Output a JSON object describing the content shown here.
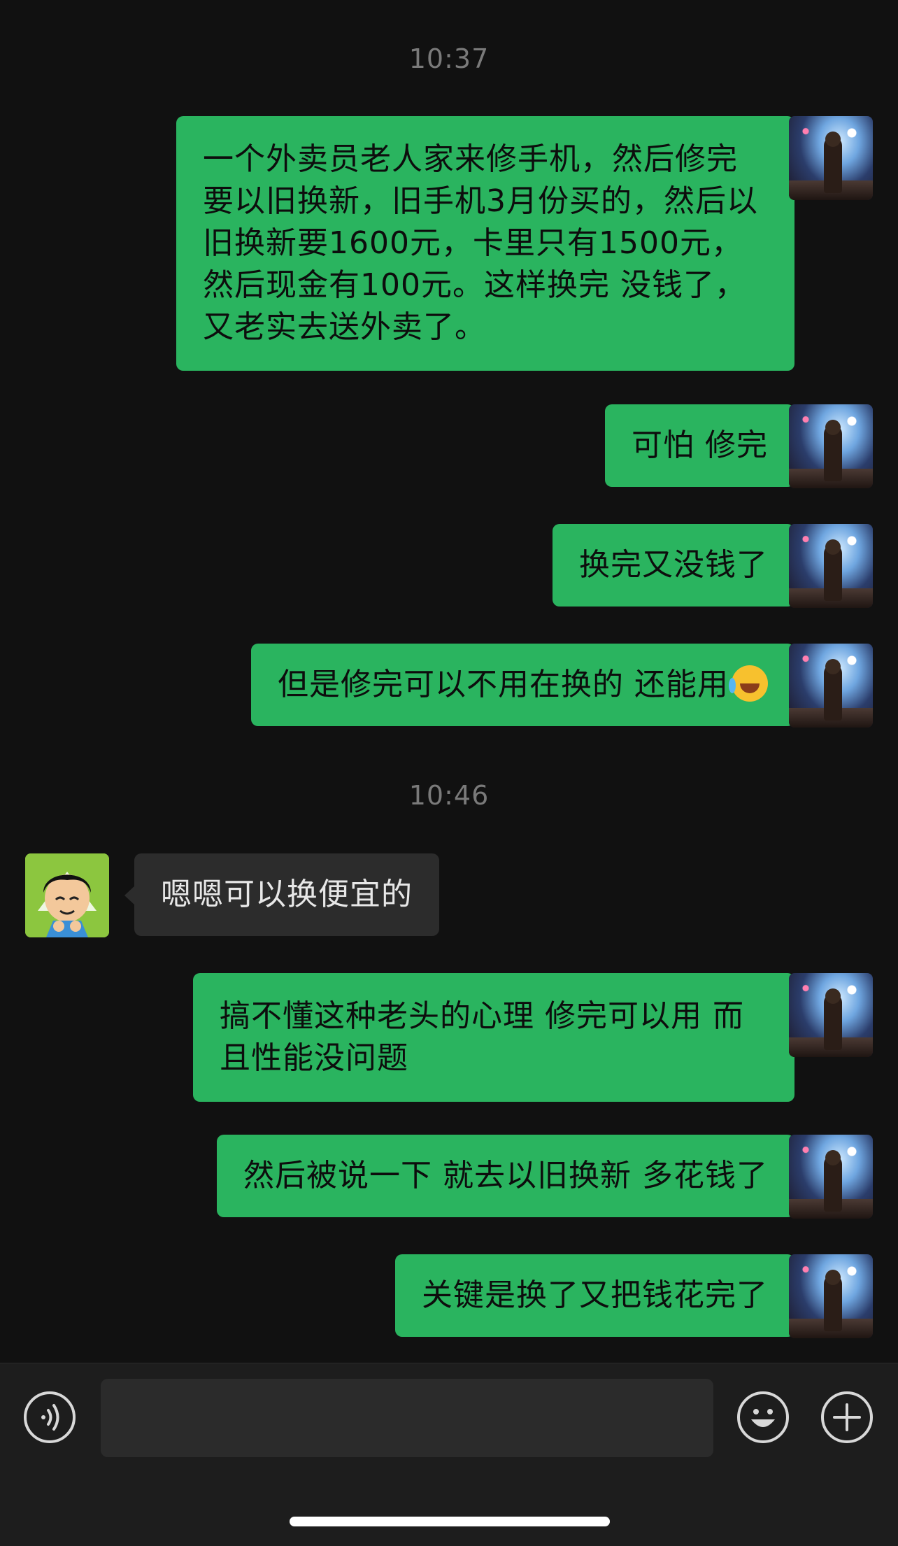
{
  "colors": {
    "background": "#111111",
    "sent_bubble": "#2ab45f",
    "received_bubble": "#2c2c2c",
    "timestamp": "#7a7a7a",
    "input_bar": "#1d1d1d"
  },
  "timestamps": [
    "10:37",
    "10:46"
  ],
  "messages": [
    {
      "sender": "me",
      "text": "一个外卖员老人家来修手机，然后修完要以旧换新，旧手机3月份买的，然后以旧换新要1600元，卡里只有1500元，然后现金有100元。这样换完 没钱了，又老实去送外卖了。"
    },
    {
      "sender": "me",
      "text": "可怕 修完"
    },
    {
      "sender": "me",
      "text": "换完又没钱了"
    },
    {
      "sender": "me",
      "text": "但是修完可以不用在换的 还能用",
      "emoji": "crying-laughing-emoji"
    },
    {
      "sender": "other",
      "text": "嗯嗯可以换便宜的"
    },
    {
      "sender": "me",
      "text": "搞不懂这种老头的心理 修完可以用 而且性能没问题"
    },
    {
      "sender": "me",
      "text": "然后被说一下 就去以旧换新 多花钱了"
    },
    {
      "sender": "me",
      "text": "关键是换了又把钱花完了"
    }
  ],
  "input_bar": {
    "voice_icon": "voice-icon",
    "emoji_icon": "smiley-icon",
    "plus_icon": "plus-icon",
    "placeholder": ""
  }
}
